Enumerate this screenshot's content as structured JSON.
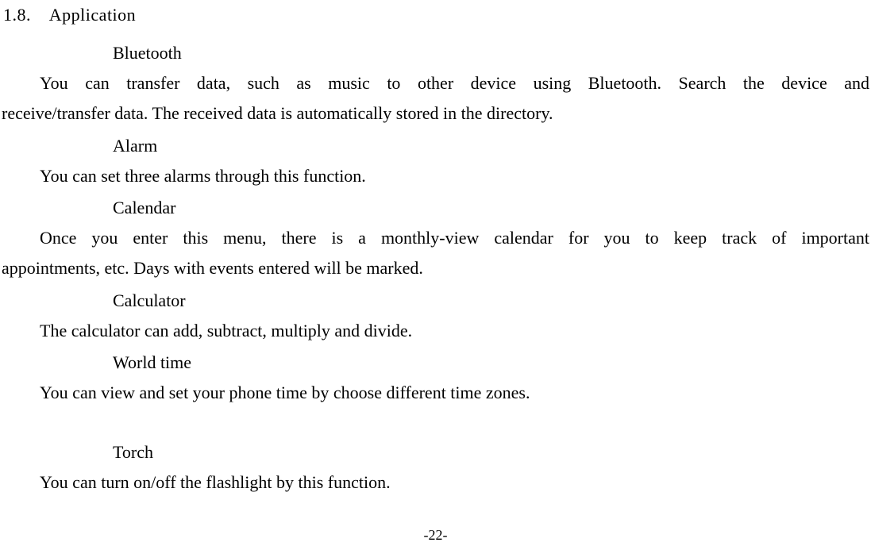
{
  "section": {
    "number": "1.8.",
    "title": "Application"
  },
  "items": {
    "bluetooth": {
      "heading": "Bluetooth",
      "line1": "You can transfer data, such as music to other device using Bluetooth. Search the device and",
      "line2": "receive/transfer data. The received data is automatically stored in the directory."
    },
    "alarm": {
      "heading": "Alarm",
      "text": "You can set three alarms through this function."
    },
    "calendar": {
      "heading": "Calendar",
      "line1": "Once you enter this menu, there is a monthly-view calendar for you to keep track of important",
      "line2": "appointments, etc. Days with events entered will be marked."
    },
    "calculator": {
      "heading": "Calculator",
      "text": "The calculator can add, subtract, multiply and divide."
    },
    "worldtime": {
      "heading": "World time",
      "text": "You can view and set your phone time by choose different time zones."
    },
    "torch": {
      "heading": "Torch",
      "text": "You can turn on/off the flashlight by this function."
    }
  },
  "pageNumber": "-22-"
}
